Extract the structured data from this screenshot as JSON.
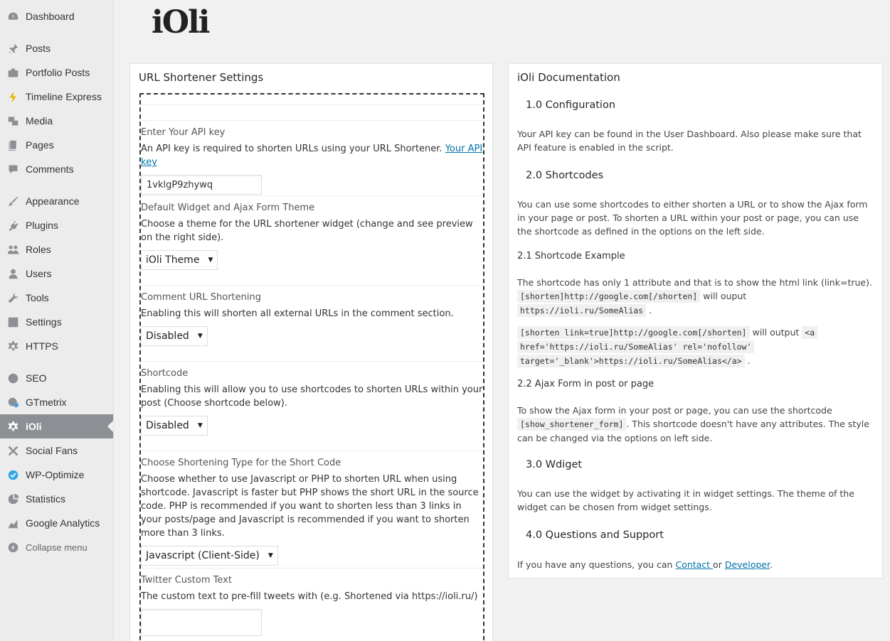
{
  "sidebar": {
    "items": [
      {
        "label": "Dashboard",
        "icon": "dashboard-icon"
      },
      {
        "label": "Posts",
        "icon": "pin-icon"
      },
      {
        "label": "Portfolio Posts",
        "icon": "portfolio-icon"
      },
      {
        "label": "Timeline Express",
        "icon": "timeline-icon"
      },
      {
        "label": "Media",
        "icon": "media-icon"
      },
      {
        "label": "Pages",
        "icon": "pages-icon"
      },
      {
        "label": "Comments",
        "icon": "comments-icon"
      },
      {
        "label": "Appearance",
        "icon": "brush-icon"
      },
      {
        "label": "Plugins",
        "icon": "plug-icon"
      },
      {
        "label": "Roles",
        "icon": "roles-icon"
      },
      {
        "label": "Users",
        "icon": "users-icon"
      },
      {
        "label": "Tools",
        "icon": "wrench-icon"
      },
      {
        "label": "Settings",
        "icon": "settings-icon"
      },
      {
        "label": "HTTPS",
        "icon": "gear-icon"
      },
      {
        "label": "SEO",
        "icon": "seo-icon"
      },
      {
        "label": "GTmetrix",
        "icon": "gtmetrix-icon"
      },
      {
        "label": "iOli",
        "icon": "gear-icon"
      },
      {
        "label": "Social Fans",
        "icon": "social-icon"
      },
      {
        "label": "WP-Optimize",
        "icon": "optimize-icon"
      },
      {
        "label": "Statistics",
        "icon": "pie-icon"
      },
      {
        "label": "Google Analytics",
        "icon": "chart-icon"
      }
    ],
    "collapse_label": "Collapse menu",
    "active": "iOli"
  },
  "logo": "iOli",
  "settings": {
    "title": "URL Shortener Settings",
    "api": {
      "title": "Enter Your API key",
      "desc": "An API key is required to shorten URLs using your URL Shortener. ",
      "link": "Your API key",
      "value": "1vklgP9zhywq"
    },
    "theme": {
      "title": "Default Widget and Ajax Form Theme",
      "desc": "Choose a theme for the URL shortener widget (change and see preview on the right side).",
      "value": "iOli Theme"
    },
    "comment": {
      "title": "Comment URL Shortening",
      "desc": "Enabling this will shorten all external URLs in the comment section.",
      "value": "Disabled"
    },
    "shortcode": {
      "title": "Shortcode",
      "desc": "Enabling this will allow you to use shortcodes to shorten URLs within your post (Choose shortcode below).",
      "value": "Disabled"
    },
    "type": {
      "title": "Choose Shortening Type for the Short Code",
      "desc": "Choose whether to use Javascript or PHP to shorten URL when using shortcode. Javascript is faster but PHP shows the short URL in the source code. PHP is recommended if you want to shorten less than 3 links in your posts/page and Javascript is recommended if you want to shorten more than 3 links.",
      "value": "Javascript (Client-Side)"
    },
    "twitter": {
      "title": "Twitter Custom Text",
      "desc": "The custom text to pre-fill tweets with (e.g. Shortened via https://ioli.ru/)",
      "value": ""
    }
  },
  "docs": {
    "title": "iOli Documentation",
    "h1": "1.0 Configuration",
    "p1": "Your API key can be found in the User Dashboard. Also please make sure that API feature is enabled in the script.",
    "h2": "2.0 Shortcodes",
    "p2": "You can use some shortcodes to either shorten a URL or to show the Ajax form in your page or post. To shorten a URL within your post or page, you can use the shortcode as defined in the options on the left side.",
    "h21": "2.1 Shortcode Example",
    "p3": "The shortcode has only 1 attribute and that is to show the html link (link=true).",
    "code1": "[shorten]http://google.com[/shorten]",
    "t1": " will ouput",
    "code2": "https://ioli.ru/SomeAlias",
    "code3": "[shorten link=true]http://google.com[/shorten]",
    "t2": " will output ",
    "code4a": "<a",
    "code4b": "href='https://ioli.ru/SomeAlias' rel='nofollow'",
    "code4c": "target='_blank'>https://ioli.ru/SomeAlias</a>",
    "h22": "2.2 Ajax Form in post or page",
    "p4a": "To show the Ajax form in your post or page, you can use the shortcode",
    "code5": "[show_shortener_form]",
    "p4b": ". This shortcode doesn't have any attributes. The style",
    "p4c": "can be changed via the options on left side.",
    "h3": "3.0 Wdiget",
    "p5": "You can use the widget by activating it in widget settings. The theme of the widget can be chosen from widget settings.",
    "h4": "4.0 Questions and Support",
    "p6a": "If you have any questions, you can ",
    "contact": "Contact ",
    "p6b": "or ",
    "developer": "Developer",
    "p6c": "."
  }
}
